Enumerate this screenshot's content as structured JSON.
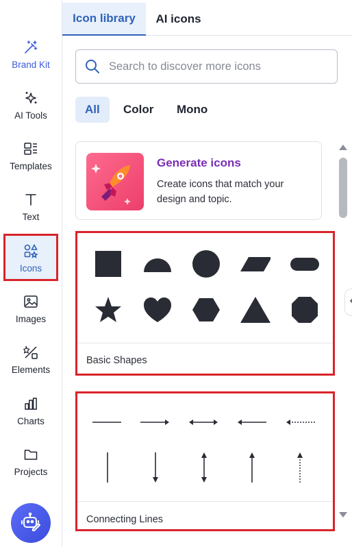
{
  "sidebar": {
    "items": [
      {
        "label": "Brand Kit",
        "icon": "magic-wand-icon"
      },
      {
        "label": "AI Tools",
        "icon": "sparkles-icon"
      },
      {
        "label": "Templates",
        "icon": "templates-icon"
      },
      {
        "label": "Text",
        "icon": "text-icon"
      },
      {
        "label": "Icons",
        "icon": "shapes-icon"
      },
      {
        "label": "Images",
        "icon": "image-icon"
      },
      {
        "label": "Elements",
        "icon": "elements-icon"
      },
      {
        "label": "Charts",
        "icon": "bar-chart-icon"
      },
      {
        "label": "Projects",
        "icon": "folder-icon"
      }
    ],
    "active": "Icons",
    "assistant_icon": "robot-assistant-icon"
  },
  "tabs": [
    {
      "label": "Icon library",
      "active": true
    },
    {
      "label": "AI icons",
      "active": false
    }
  ],
  "search": {
    "placeholder": "Search to discover more icons",
    "value": ""
  },
  "filters": [
    {
      "label": "All",
      "selected": true
    },
    {
      "label": "Color",
      "selected": false
    },
    {
      "label": "Mono",
      "selected": false
    }
  ],
  "generate_card": {
    "title": "Generate icons",
    "description": "Create icons that match your design and topic.",
    "icon": "rocket-icon"
  },
  "categories": [
    {
      "name": "Basic Shapes",
      "items": [
        "square",
        "half-circle",
        "circle",
        "parallelogram",
        "pill",
        "star",
        "heart",
        "hexagon",
        "triangle",
        "octagon"
      ]
    },
    {
      "name": "Connecting Lines",
      "items": [
        "horizontal-line",
        "right-arrow",
        "double-arrow",
        "left-arrow",
        "dotted-left-arrow",
        "vertical-line",
        "down-arrow",
        "vertical-double-arrow",
        "up-arrow",
        "dotted-up-arrow"
      ]
    }
  ],
  "colors": {
    "accent": "#2f63b8",
    "active_bg": "#e8f0fc",
    "highlight": "#d9232a",
    "generate_title": "#7a2db3",
    "shape_fill": "#2a2c35"
  }
}
